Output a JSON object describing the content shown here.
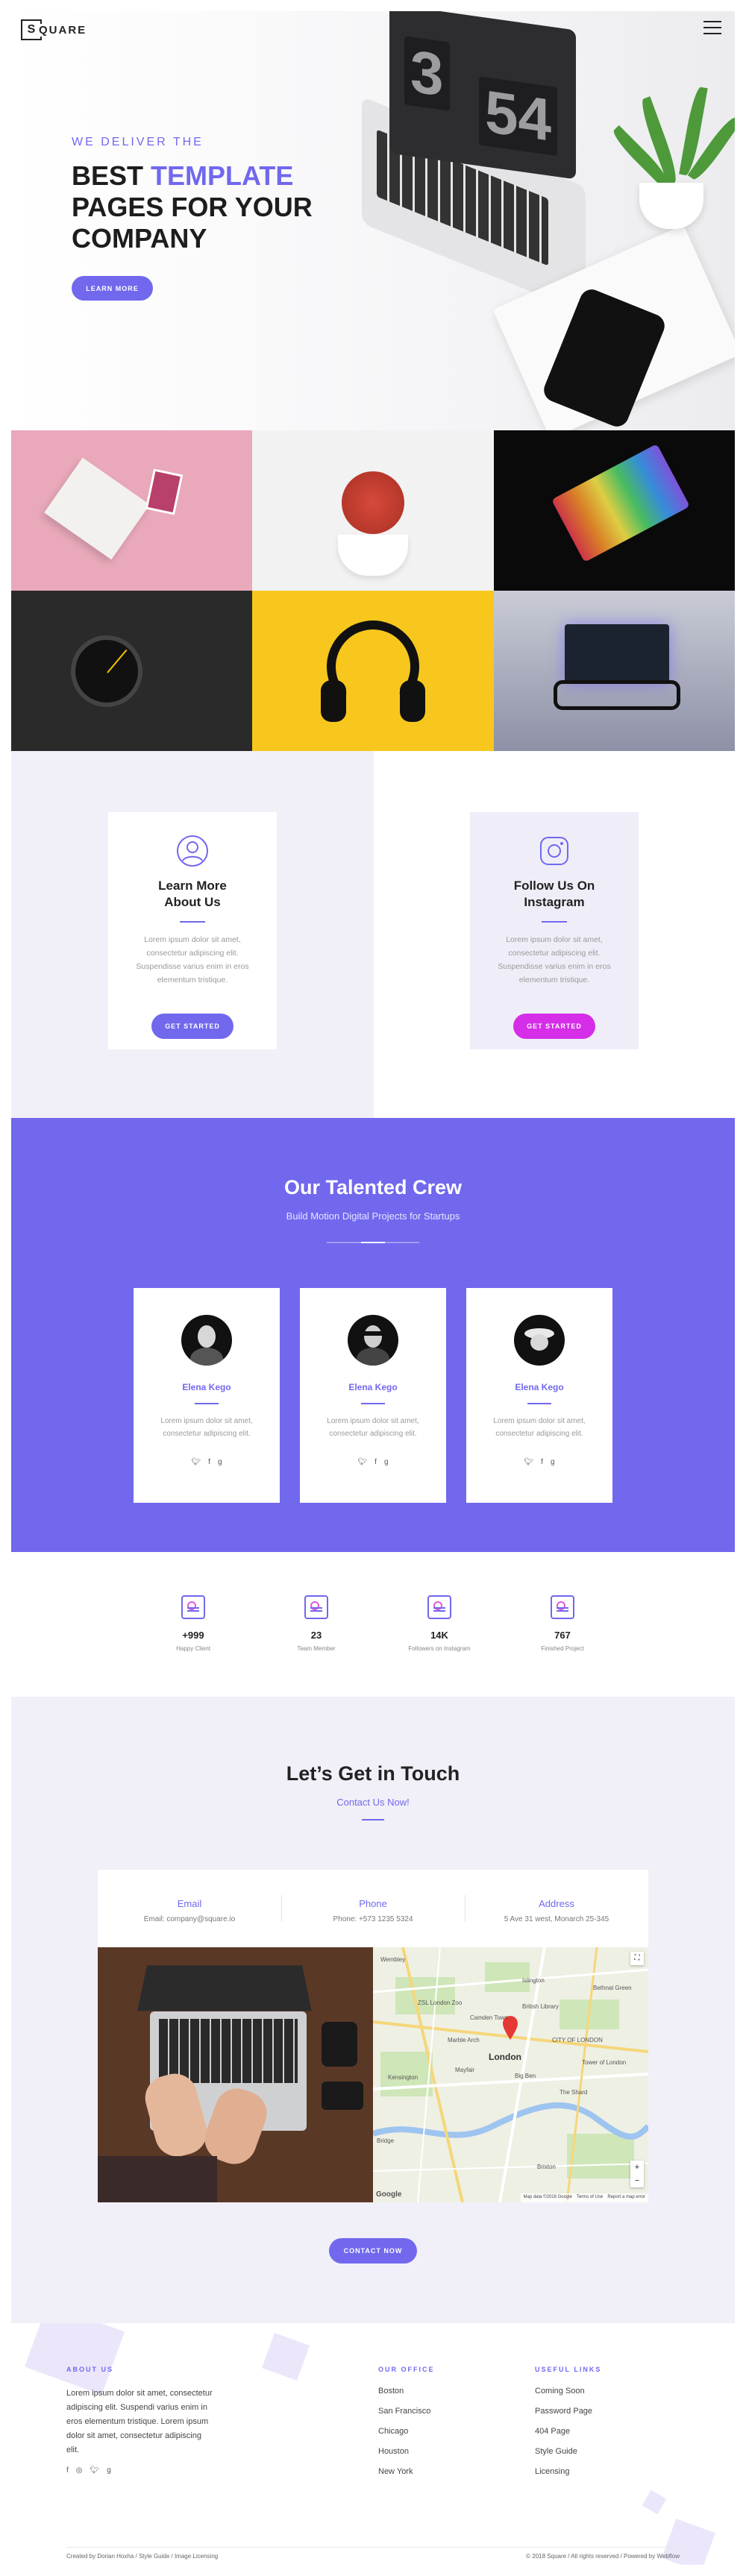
{
  "brand": {
    "logo_letter": "S",
    "logo_rest": "QUARE"
  },
  "hero": {
    "eyebrow": "WE DELIVER THE",
    "title_part1": "BEST ",
    "title_highlight": "TEMPLATE",
    "title_part2": "PAGES FOR YOUR COMPANY",
    "button": "LEARN MORE",
    "laptop_digits_1": "3",
    "laptop_digits_2": "54"
  },
  "features": [
    {
      "title": "Learn More About Us",
      "text": "Lorem ipsum dolor sit amet, consectetur adipiscing elit. Suspendisse varius enim in eros elementum tristique.",
      "button": "GET STARTED",
      "icon": "user-icon",
      "button_color": "#7168ee"
    },
    {
      "title": "Follow Us On Instagram",
      "text": "Lorem ipsum dolor sit amet, consectetur adipiscing elit. Suspendisse varius enim in eros elementum tristique.",
      "button": "GET STARTED",
      "icon": "instagram-icon",
      "button_color": "#d52de8"
    }
  ],
  "crew": {
    "title": "Our Talented Crew",
    "subtitle": "Build Motion Digital Projects for Startups",
    "members": [
      {
        "name": "Elena Kego",
        "text": "Lorem ipsum dolor sit amet, consectetur adipiscing elit."
      },
      {
        "name": "Elena Kego",
        "text": "Lorem ipsum dolor sit amet, consectetur adipiscing elit."
      },
      {
        "name": "Elena Kego",
        "text": "Lorem ipsum dolor sit amet, consectetur adipiscing elit."
      }
    ],
    "social": [
      "twitter-icon",
      "facebook-icon",
      "google-plus-icon"
    ]
  },
  "stats": [
    {
      "value": "+999",
      "label": "Happy Client"
    },
    {
      "value": "23",
      "label": "Team Member"
    },
    {
      "value": "14K",
      "label": "Followers on Instagram"
    },
    {
      "value": "767",
      "label": "Finished Project"
    }
  ],
  "contact": {
    "title": "Let’s Get in Touch",
    "subtitle": "Contact Us Now!",
    "info": [
      {
        "label": "Email",
        "value": "Email: company@square.io"
      },
      {
        "label": "Phone",
        "value": "Phone: +573 1235 5324"
      },
      {
        "label": "Address",
        "value": "5 Ave 31 west, Monarch 25-345"
      }
    ],
    "map": {
      "places": [
        "British Library",
        "Marble Arch",
        "Mayfair",
        "London",
        "Big Ben",
        "The Shard",
        "CITY OF LONDON",
        "Brixton",
        "Kensington",
        "Tower of London",
        "Bethnal Green",
        "Islington",
        "Wembley",
        "Bridge",
        "Camden Town",
        "ZSL London Zoo"
      ],
      "attribution": "Map data ©2018 Google",
      "terms": "Terms of Use",
      "report": "Report a map error",
      "google": "Google",
      "zoom_in": "+",
      "zoom_out": "−"
    },
    "button": "CONTACT NOW"
  },
  "footer": {
    "about_head": "ABOUT US",
    "about_text": "Lorem ipsum dolor sit amet, consectetur adipiscing elit. Suspendi varius enim in eros elementum tristique. Lorem ipsum dolor sit amet, consectetur adipiscing elit.",
    "office_head": "OUR OFFICE",
    "offices": [
      "Boston",
      "San Francisco",
      "Chicago",
      "Houston",
      "New York"
    ],
    "links_head": "USEFUL LINKS",
    "links": [
      "Coming Soon",
      "Password Page",
      "404 Page",
      "Style Guide",
      "Licensing"
    ],
    "social": [
      "facebook-icon",
      "instagram-icon",
      "twitter-icon",
      "google-plus-icon"
    ],
    "credit": "Created by Dorian Hoxha / Style Guide / Image Licensing",
    "copyright": "© 2018 Square / All rights reserved / Powered by Webflow"
  }
}
